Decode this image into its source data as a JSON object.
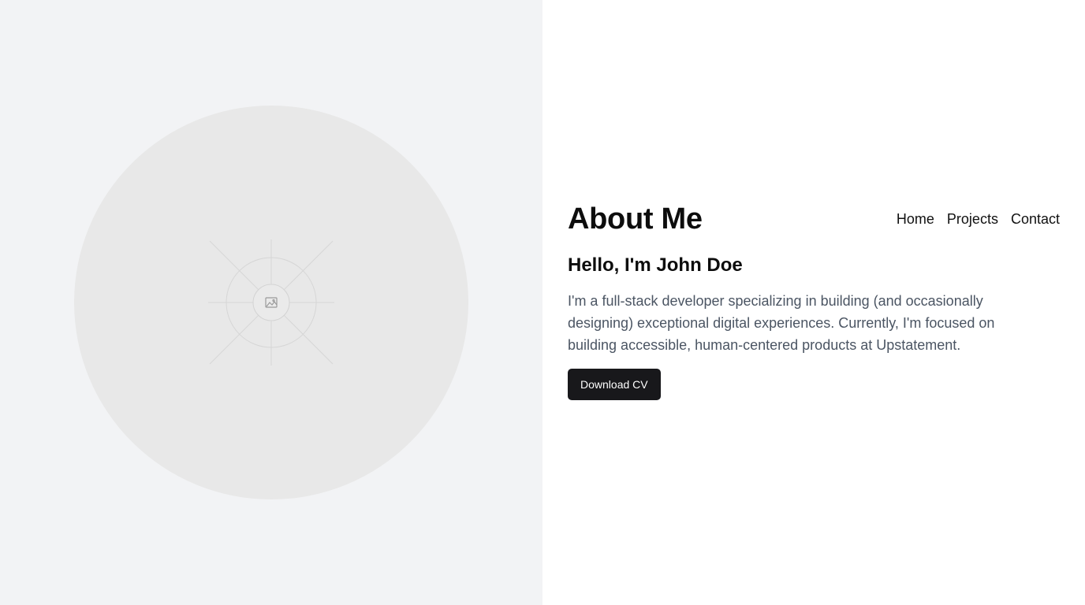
{
  "profile_image": {
    "icon": "image-placeholder-icon"
  },
  "header": {
    "title": "About Me"
  },
  "nav": {
    "items": [
      {
        "label": "Home"
      },
      {
        "label": "Projects"
      },
      {
        "label": "Contact"
      }
    ]
  },
  "main": {
    "greeting": "Hello, I'm John Doe",
    "bio": "I'm a full-stack developer specializing in building (and occasionally designing) exceptional digital experiences. Currently, I'm focused on building accessible, human-centered products at Upstatement.",
    "download_label": "Download CV"
  },
  "colors": {
    "left_panel_bg": "#f2f3f5",
    "avatar_bg": "#e8e8e8",
    "button_bg": "#18181b",
    "body_text": "#4b5563"
  }
}
